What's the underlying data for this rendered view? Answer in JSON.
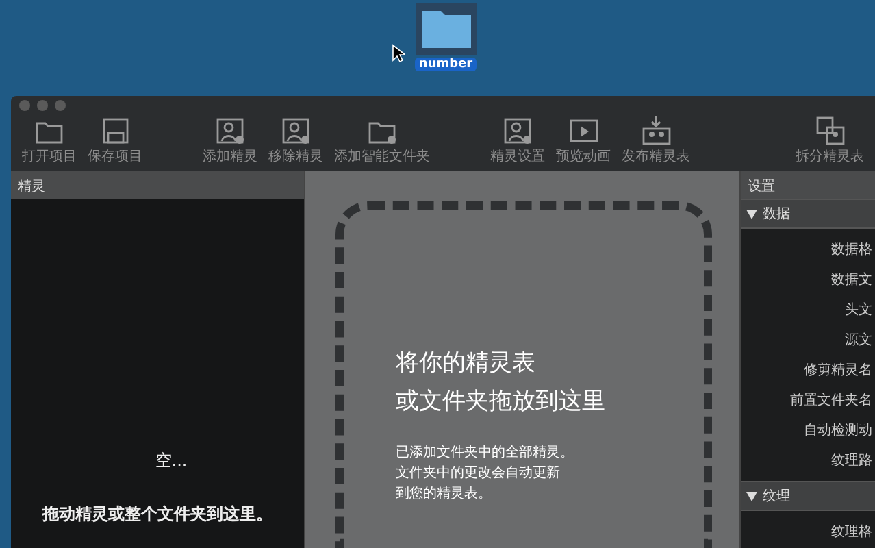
{
  "desktop": {
    "folder_label": "number"
  },
  "toolbar_groups": [
    {
      "buttons": [
        {
          "kind": "folder",
          "label": "打开项目"
        },
        {
          "kind": "disk",
          "label": "保存项目"
        }
      ]
    },
    {
      "buttons": [
        {
          "kind": "person-add",
          "label": "添加精灵"
        },
        {
          "kind": "person-remove",
          "label": "移除精灵"
        },
        {
          "kind": "folder-add",
          "label": "添加智能文件夹"
        }
      ]
    },
    {
      "buttons": [
        {
          "kind": "person-gear",
          "label": "精灵设置"
        },
        {
          "kind": "play",
          "label": "预览动画"
        },
        {
          "kind": "publish",
          "label": "发布精灵表"
        }
      ]
    },
    {
      "buttons": [
        {
          "kind": "split",
          "label": "拆分精灵表"
        }
      ]
    }
  ],
  "sprites_panel": {
    "title": "精灵",
    "empty": "空...",
    "hint": "拖动精灵或整个文件夹到这里。"
  },
  "drop_zone": {
    "heading": [
      "将你的精灵表",
      "或文件夹拖放到这里"
    ],
    "description": [
      "已添加文件夹中的全部精灵。",
      "文件夹中的更改会自动更新",
      "到您的精灵表。"
    ]
  },
  "settings_panel": {
    "title": "设置",
    "sections": [
      {
        "title": "数据",
        "expanded": true,
        "items": [
          "数据格",
          "数据文",
          "头文",
          "源文",
          "修剪精灵名",
          "前置文件夹名",
          "自动检测动",
          "纹理路"
        ]
      },
      {
        "title": "纹理",
        "expanded": true,
        "items": [
          "纹理格"
        ]
      }
    ]
  }
}
